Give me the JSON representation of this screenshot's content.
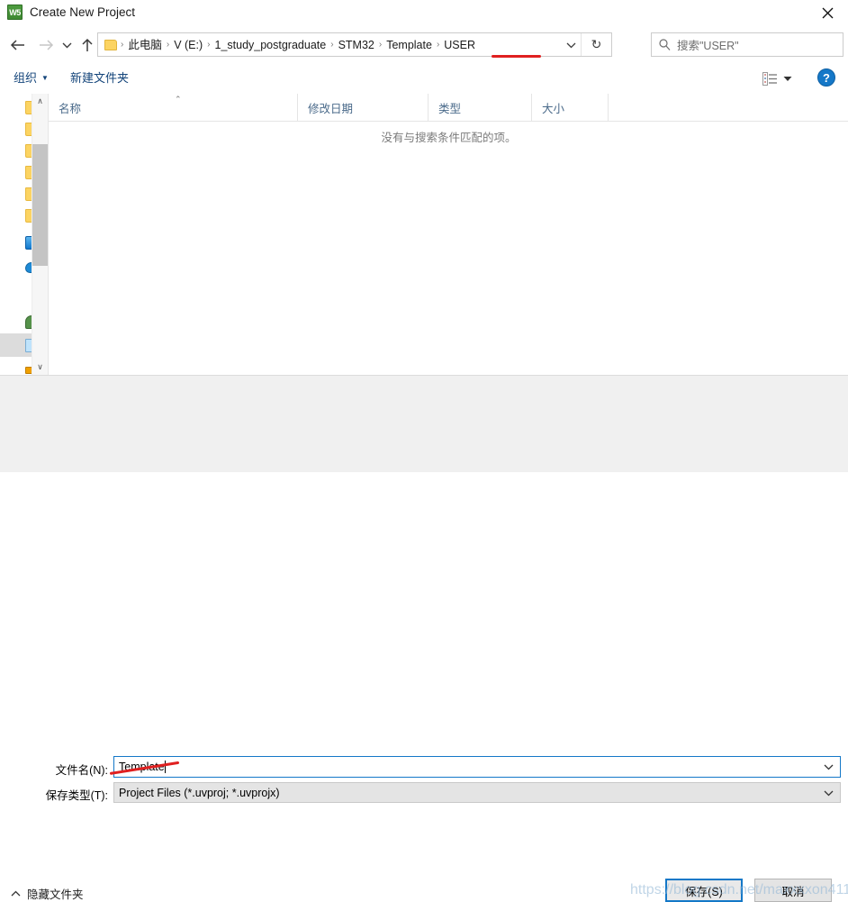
{
  "window": {
    "title": "Create New Project",
    "icon": "keil-uvision-icon",
    "icon_glyph": "W5",
    "close_label": "✕"
  },
  "nav": {
    "back": "←",
    "forward": "→",
    "recent": "⌄",
    "up": "↑",
    "dropdown": "⌄",
    "refresh": "↻"
  },
  "breadcrumb": {
    "separator": "›",
    "items": [
      {
        "label": "此电脑"
      },
      {
        "label": "V (E:)"
      },
      {
        "label": "1_study_postgraduate"
      },
      {
        "label": "STM32"
      },
      {
        "label": "Template"
      },
      {
        "label": "USER"
      }
    ]
  },
  "search": {
    "placeholder": "搜索\"USER\"",
    "icon": "search-icon"
  },
  "toolbar": {
    "organize_label": "组织",
    "organize_caret": "▼",
    "new_folder_label": "新建文件夹",
    "view_caret": "▼",
    "help_label": "?"
  },
  "sidebar": {
    "items": [
      {
        "icon": "folder-icon"
      },
      {
        "icon": "folder-icon"
      },
      {
        "icon": "folder-icon"
      },
      {
        "icon": "folder-icon"
      },
      {
        "icon": "folder-icon"
      },
      {
        "icon": "folder-icon"
      },
      {
        "icon": "monitor-icon"
      },
      {
        "icon": "onedrive-icon"
      },
      {
        "icon": "person-icon"
      },
      {
        "icon": "this-pc-icon"
      },
      {
        "icon": "disk-icon"
      }
    ],
    "scroll_up": "∧",
    "scroll_down": "∨"
  },
  "filelist": {
    "columns": [
      {
        "label": "名称"
      },
      {
        "label": "修改日期"
      },
      {
        "label": "类型"
      },
      {
        "label": "大小"
      }
    ],
    "sort_indicator": "⌃",
    "empty_message": "没有与搜索条件匹配的项。",
    "rows": []
  },
  "form": {
    "filename_label": "文件名(N):",
    "filename_value": "Template",
    "filetype_label": "保存类型(T):",
    "filetype_value": "Project Files (*.uvproj; *.uvprojx)",
    "chevron": "⌄"
  },
  "footer": {
    "hide_folders_label": "隐藏文件夹",
    "hide_folders_chevron": "∧",
    "save_label": "保存(S)",
    "cancel_label": "取消"
  },
  "annotations": {
    "watermark_text": "https://blog.csdn.net/maxxxxon411",
    "underline_color": "#e02020"
  }
}
